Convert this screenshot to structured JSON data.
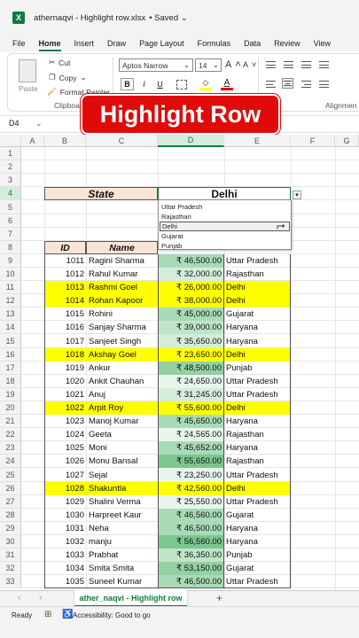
{
  "titlebar": {
    "filename": "athernaqvi - Highlight row.xlsx",
    "saved": "• Saved ⌄"
  },
  "menu": [
    "File",
    "Home",
    "Insert",
    "Draw",
    "Page Layout",
    "Formulas",
    "Data",
    "Review",
    "View"
  ],
  "ribbon": {
    "paste": "Paste",
    "cut": "Cut",
    "copy": "Copy",
    "format_painter": "Format Painter",
    "clipboard": "Clipboard",
    "font_name": "Aptos Narrow",
    "font_size": "14",
    "bold": "B",
    "italic": "I",
    "underline": "U",
    "grow": "A",
    "shrink": "A",
    "font_color_letter": "A",
    "alignment": "Alignmen"
  },
  "banner": "Highlight Row",
  "namebox": "D4",
  "columns": [
    "A",
    "B",
    "C",
    "D",
    "E",
    "F",
    "G"
  ],
  "rows": [
    1,
    2,
    3,
    4,
    5,
    6,
    7,
    8,
    9,
    10,
    11,
    12,
    13,
    14,
    15,
    16,
    17,
    18,
    19,
    20,
    21,
    22,
    23,
    24,
    25,
    26,
    27,
    28,
    29,
    30,
    31,
    32,
    33
  ],
  "state_label": "State",
  "state_value": "Delhi",
  "dropdown_options": [
    "Uttar Pradesh",
    "Rajasthan",
    "Delhi",
    "Gujarat",
    "Punjab"
  ],
  "headers": {
    "id": "ID",
    "name": "Name"
  },
  "table": [
    {
      "id": "1011",
      "name": "Ragini Sharma",
      "amount": "₹ 46,500.00",
      "state": "Uttar Pradesh",
      "hl": false,
      "g": 3
    },
    {
      "id": "1012",
      "name": "Rahul Kumar",
      "amount": "₹ 32,000.00",
      "state": "Rajasthan",
      "hl": false,
      "g": 1
    },
    {
      "id": "1013",
      "name": "Rashmi Goel",
      "amount": "₹ 26,000.00",
      "state": "Delhi",
      "hl": true,
      "g": 0
    },
    {
      "id": "1014",
      "name": "Rohan Kapoor",
      "amount": "₹ 38,000.00",
      "state": "Delhi",
      "hl": true,
      "g": 0
    },
    {
      "id": "1015",
      "name": "Rohini",
      "amount": "₹ 45,000.00",
      "state": "Gujarat",
      "hl": false,
      "g": 3
    },
    {
      "id": "1016",
      "name": "Sanjay Sharma",
      "amount": "₹ 39,000.00",
      "state": "Haryana",
      "hl": false,
      "g": 2
    },
    {
      "id": "1017",
      "name": "Sanjeet Singh",
      "amount": "₹ 35,650.00",
      "state": "Haryana",
      "hl": false,
      "g": 1
    },
    {
      "id": "1018",
      "name": "Akshay Goel",
      "amount": "₹ 23,650.00",
      "state": "Delhi",
      "hl": true,
      "g": 0
    },
    {
      "id": "1019",
      "name": "Ankur",
      "amount": "₹ 48,500.00",
      "state": "Punjab",
      "hl": false,
      "g": 4
    },
    {
      "id": "1020",
      "name": "Ankit Chauhan",
      "amount": "₹ 24,650.00",
      "state": "Uttar Pradesh",
      "hl": false,
      "g": 0
    },
    {
      "id": "1021",
      "name": "Anuj",
      "amount": "₹ 31,245.00",
      "state": "Uttar Pradesh",
      "hl": false,
      "g": 1
    },
    {
      "id": "1022",
      "name": "Arpit Roy",
      "amount": "₹ 55,600.00",
      "state": "Delhi",
      "hl": true,
      "g": 0
    },
    {
      "id": "1023",
      "name": "Manoj Kumar",
      "amount": "₹ 45,650.00",
      "state": "Haryana",
      "hl": false,
      "g": 3
    },
    {
      "id": "1024",
      "name": "Geeta",
      "amount": "₹ 24,565.00",
      "state": "Rajasthan",
      "hl": false,
      "g": 0
    },
    {
      "id": "1025",
      "name": "Moni",
      "amount": "₹ 45,652.00",
      "state": "Haryana",
      "hl": false,
      "g": 3
    },
    {
      "id": "1026",
      "name": "Monu Bansal",
      "amount": "₹ 55,650.00",
      "state": "Rajasthan",
      "hl": false,
      "g": 5
    },
    {
      "id": "1027",
      "name": "Sejal",
      "amount": "₹ 23,250.00",
      "state": "Uttar Pradesh",
      "hl": false,
      "g": 0
    },
    {
      "id": "1028",
      "name": "Shakuntla",
      "amount": "₹ 42,560.00",
      "state": "Delhi",
      "hl": true,
      "g": 0
    },
    {
      "id": "1029",
      "name": "Shalini Verma",
      "amount": "₹ 25,550.00",
      "state": "Uttar Pradesh",
      "hl": false,
      "g": 0
    },
    {
      "id": "1030",
      "name": "Harpreet Kaur",
      "amount": "₹ 46,560.00",
      "state": "Gujarat",
      "hl": false,
      "g": 3
    },
    {
      "id": "1031",
      "name": "Neha",
      "amount": "₹ 46,500.00",
      "state": "Haryana",
      "hl": false,
      "g": 3
    },
    {
      "id": "1032",
      "name": "manju",
      "amount": "₹ 56,560.00",
      "state": "Haryana",
      "hl": false,
      "g": 5
    },
    {
      "id": "1033",
      "name": "Prabhat",
      "amount": "₹ 36,350.00",
      "state": "Punjab",
      "hl": false,
      "g": 2
    },
    {
      "id": "1034",
      "name": "Smita Smita",
      "amount": "₹ 53,150.00",
      "state": "Gujarat",
      "hl": false,
      "g": 4
    },
    {
      "id": "1035",
      "name": "Suneel Kumar",
      "amount": "₹ 46,500.00",
      "state": "Uttar Pradesh",
      "hl": false,
      "g": 3
    }
  ],
  "sheet_tab": "ather_naqvi - Highlight row",
  "add_sheet": "+",
  "status": {
    "ready": "Ready",
    "accessibility": "Accessibility: Good to go"
  },
  "colors": {
    "highlight": "#ffff00",
    "header_fill": "#fce4d6",
    "banner": "#e00a0a",
    "excel_green": "#107c41",
    "gradient": [
      "#e8f5ec",
      "#d4eddb",
      "#c0e4ca",
      "#a9dab6",
      "#93d0a2",
      "#7cc68f"
    ]
  }
}
